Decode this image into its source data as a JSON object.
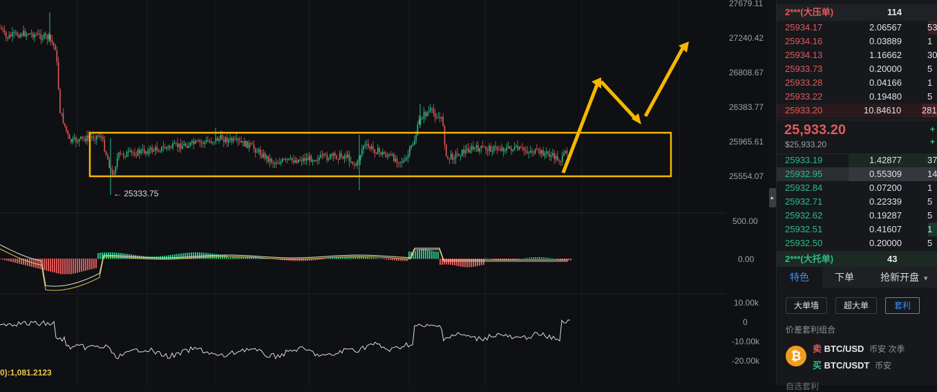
{
  "chart": {
    "price_axis": [
      "27679.11",
      "27240.42",
      "26808.67",
      "26383.77",
      "25965.61",
      "25554.07"
    ],
    "macd_axis": [
      "500.00",
      "0.00"
    ],
    "osc_axis": [
      "10.00k",
      "0",
      "-10.00k",
      "-20.00k"
    ],
    "low_marker": "← 25333.75",
    "bottom_readout": "0):1,081.2123",
    "handle_glyph": "▸",
    "colors": {
      "up": "#2ebd85",
      "down": "#e05a5a",
      "annotation": "#f5b800"
    }
  },
  "orderbook": {
    "ask_header": {
      "name": "2***(大压单)",
      "count": "114"
    },
    "asks": [
      {
        "price": "25934.17",
        "qty": "2.06567",
        "total": "53"
      },
      {
        "price": "25934.16",
        "qty": "0.03889",
        "total": "1"
      },
      {
        "price": "25934.13",
        "qty": "1.16662",
        "total": "30"
      },
      {
        "price": "25933.73",
        "qty": "0.20000",
        "total": "5"
      },
      {
        "price": "25933.28",
        "qty": "0.04166",
        "total": "1"
      },
      {
        "price": "25933.22",
        "qty": "0.19480",
        "total": "5"
      },
      {
        "price": "25933.20",
        "qty": "10.84610",
        "total": "281"
      }
    ],
    "mid_price": "25,933.20",
    "mid_usd": "$25,933.20",
    "mid_marks": [
      "+",
      "+"
    ],
    "bids": [
      {
        "price": "25933.19",
        "qty": "1.42877",
        "total": "37"
      },
      {
        "price": "25932.95",
        "qty": "0.55309",
        "total": "14"
      },
      {
        "price": "25932.84",
        "qty": "0.07200",
        "total": "1"
      },
      {
        "price": "25932.71",
        "qty": "0.22339",
        "total": "5"
      },
      {
        "price": "25932.62",
        "qty": "0.19287",
        "total": "5"
      },
      {
        "price": "25932.51",
        "qty": "0.41607",
        "total": "1"
      },
      {
        "price": "25932.50",
        "qty": "0.20000",
        "total": "5"
      }
    ],
    "bid_header": {
      "name": "2***(大托单)",
      "count": "43"
    }
  },
  "tabs": {
    "features": "特色",
    "orders": "下单",
    "grab": "抢新开盘",
    "grab_arrow": "▾"
  },
  "chips": {
    "wall": "大单墙",
    "super": "超大单",
    "arbitrage": "套利"
  },
  "combo": {
    "title": "价差套利组合",
    "logo": "₿",
    "pair1": {
      "side": "卖",
      "symbol": "BTC/USD",
      "venue": "币安 次季"
    },
    "pair2": {
      "side": "买",
      "symbol": "BTC/USDT",
      "venue": "币安"
    }
  },
  "cutoff_text": "自选套利"
}
